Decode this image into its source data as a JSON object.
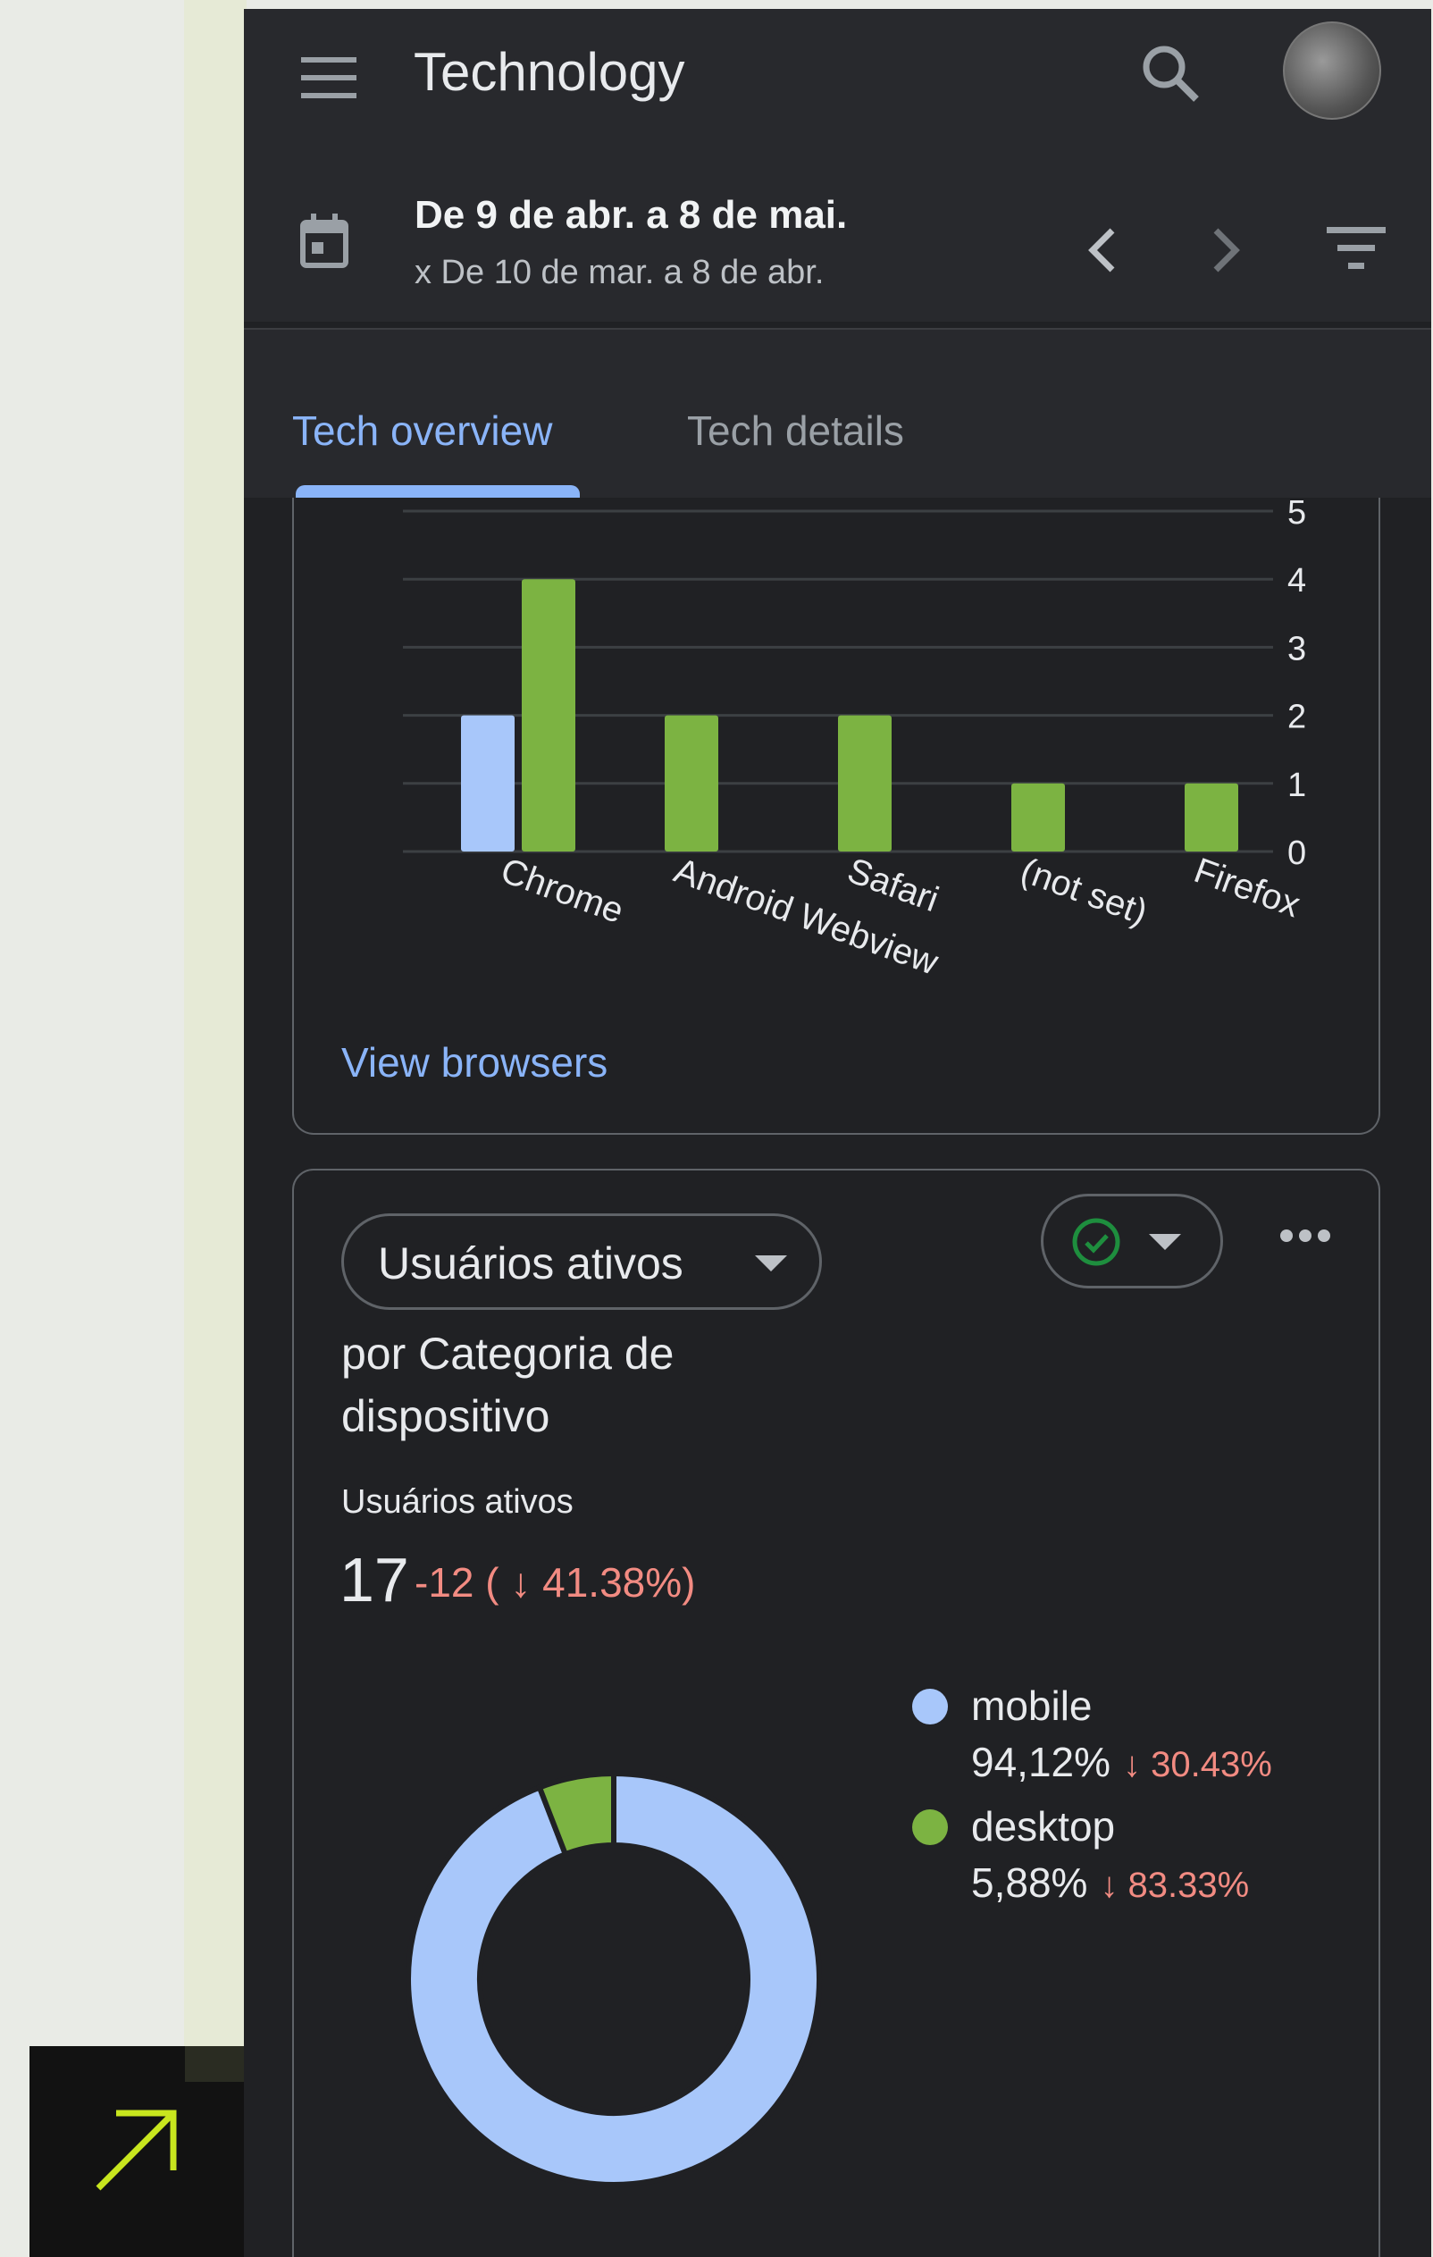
{
  "app": {
    "title": "Technology"
  },
  "icons": {
    "menu": "menu-icon",
    "search": "search-icon",
    "calendar": "calendar-icon",
    "prev": "chevron-left-icon",
    "next": "chevron-right-icon",
    "filter": "filter-icon",
    "more": "more-horiz-icon",
    "check": "check-circle-icon",
    "external": "arrow-up-right-icon"
  },
  "date_range": {
    "primary": "De 9 de abr. a 8 de mai.",
    "comparison": "x De 10 de mar. a 8 de abr."
  },
  "tabs": [
    {
      "label": "Tech overview",
      "active": true
    },
    {
      "label": "Tech details",
      "active": false
    }
  ],
  "browsers_card": {
    "link_label": "View browsers"
  },
  "chart_data": [
    {
      "type": "bar",
      "categories": [
        "Chrome",
        "Android Webview",
        "Safari",
        "(not set)",
        "Firefox"
      ],
      "series": [
        {
          "values": [
            2,
            0,
            0,
            0,
            0
          ],
          "color": "#a8c7fa"
        },
        {
          "values": [
            4,
            2,
            2,
            1,
            1
          ],
          "color": "#7cb342"
        }
      ],
      "yticks": [
        0,
        1,
        2,
        3,
        4,
        5
      ],
      "ylim": [
        0,
        5
      ],
      "y_axis_side": "right",
      "grid": true
    },
    {
      "type": "pie",
      "categories": [
        "mobile",
        "desktop"
      ],
      "values": [
        94.12,
        5.88
      ],
      "colors": [
        "#a8c7fa",
        "#7cb342"
      ],
      "donut": true
    }
  ],
  "device_card": {
    "metric_selector": "Usuários ativos",
    "by_label": " por Categoria de dispositivo",
    "metric_name": "Usuários ativos",
    "metric_value": "17",
    "metric_delta": "-12 ( ↓ 41.38%)",
    "legend": [
      {
        "name": "mobile",
        "share": "94,12%",
        "delta": "↓ 30.43%",
        "color": "#a8c7fa"
      },
      {
        "name": "desktop",
        "share": "5,88%",
        "delta": "↓ 83.33%",
        "color": "#7cb342"
      }
    ]
  },
  "colors": {
    "accent": "#8ab4f8",
    "negative": "#f28b82",
    "series_a": "#a8c7fa",
    "series_b": "#7cb342"
  }
}
